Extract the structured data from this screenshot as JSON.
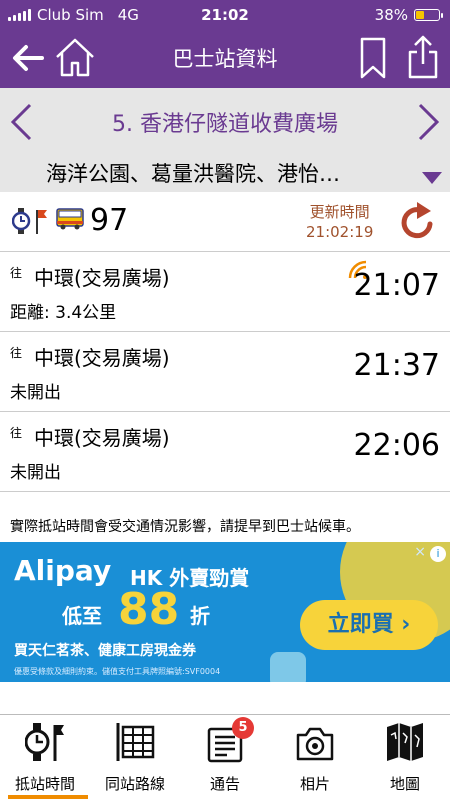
{
  "status": {
    "carrier": "Club Sim",
    "network": "4G",
    "time": "21:02",
    "battery": "38%",
    "battery_level": 0.38
  },
  "nav": {
    "title": "巴士站資料"
  },
  "stop": {
    "name": "5. 香港仔隧道收費廣場",
    "nearby": "海洋公園、葛量洪醫院、港怡…"
  },
  "route": {
    "number": "97",
    "updated_label": "更新時間",
    "updated_time": "21:02:19"
  },
  "etas": [
    {
      "to_label": "往",
      "destination": "中環(交易廣場)",
      "sub": "距離: 3.4公里",
      "time": "21:07",
      "live": true
    },
    {
      "to_label": "往",
      "destination": "中環(交易廣場)",
      "sub": "未開出",
      "time": "21:37",
      "live": false
    },
    {
      "to_label": "往",
      "destination": "中環(交易廣場)",
      "sub": "未開出",
      "time": "22:06",
      "live": false
    }
  ],
  "notice": "實際抵站時間會受交通情況影響，請提早到巴士站候車。",
  "ad": {
    "brand": "Alipay",
    "headline": "HK 外賣勁賞",
    "low": "低至",
    "big": "88",
    "off": "折",
    "stores": "買天仁茗茶、健康工房現金券",
    "fine": "優惠受條款及細則約束。儲值支付工具牌照編號:SVF0004",
    "cta": "立即買 ›",
    "info": "i",
    "close": "×"
  },
  "tabs": [
    {
      "label": "抵站時間",
      "active": true
    },
    {
      "label": "同站路線",
      "active": false
    },
    {
      "label": "通告",
      "active": false,
      "badge": "5"
    },
    {
      "label": "相片",
      "active": false
    },
    {
      "label": "地圖",
      "active": false
    }
  ],
  "colors": {
    "brand": "#6a3a91",
    "ad_blue": "#1a8fd6",
    "accent": "#f08c00",
    "update_text": "#a0522d"
  }
}
